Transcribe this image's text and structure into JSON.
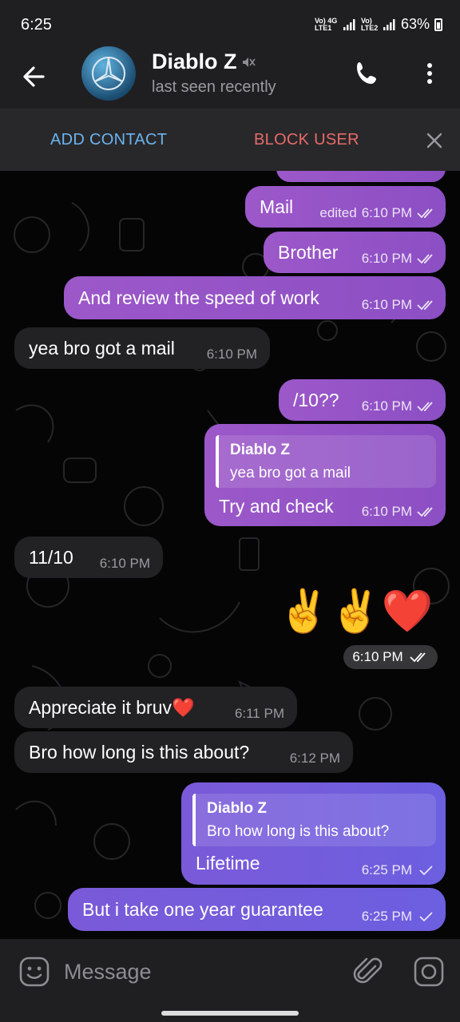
{
  "status": {
    "time": "6:25",
    "net1": "Vo) 4G LTE1",
    "net2": "Vo) LTE2",
    "battery": "63%"
  },
  "header": {
    "name": "Diablo Z",
    "last_seen": "last seen recently"
  },
  "actions": {
    "add_contact": "ADD CONTACT",
    "block_user": "BLOCK USER"
  },
  "messages": [
    {
      "text": "Mail",
      "edited": "edited",
      "time": "6:10 PM"
    },
    {
      "text": "Brother",
      "time": "6:10 PM"
    },
    {
      "text": "And review the speed of work",
      "time": "6:10 PM"
    },
    {
      "text": "yea bro got a mail",
      "time": "6:10 PM"
    },
    {
      "text": "/10??",
      "time": "6:10 PM"
    },
    {
      "reply_name": "Diablo Z",
      "reply_text": "yea bro got a mail",
      "text": "Try and check",
      "time": "6:10 PM"
    },
    {
      "text": "11/10",
      "time": "6:10 PM"
    },
    {
      "emoji": "✌️✌️❤️",
      "time": "6:10 PM"
    },
    {
      "text": "Appreciate it  bruv❤️",
      "time": "6:11 PM"
    },
    {
      "text": "Bro how long is this about?",
      "time": "6:12 PM"
    },
    {
      "reply_name": "Diablo Z",
      "reply_text": "Bro how long is this about?",
      "text": "Lifetime",
      "time": "6:25 PM"
    },
    {
      "text": "But i take one year guarantee",
      "time": "6:25 PM"
    }
  ],
  "input": {
    "placeholder": "Message"
  },
  "colors": {
    "outgoing": "#9c58c9",
    "outgoing_recent": "#6c5fe0",
    "incoming": "#222224",
    "link": "#6db3ee",
    "danger": "#e86a6a"
  }
}
